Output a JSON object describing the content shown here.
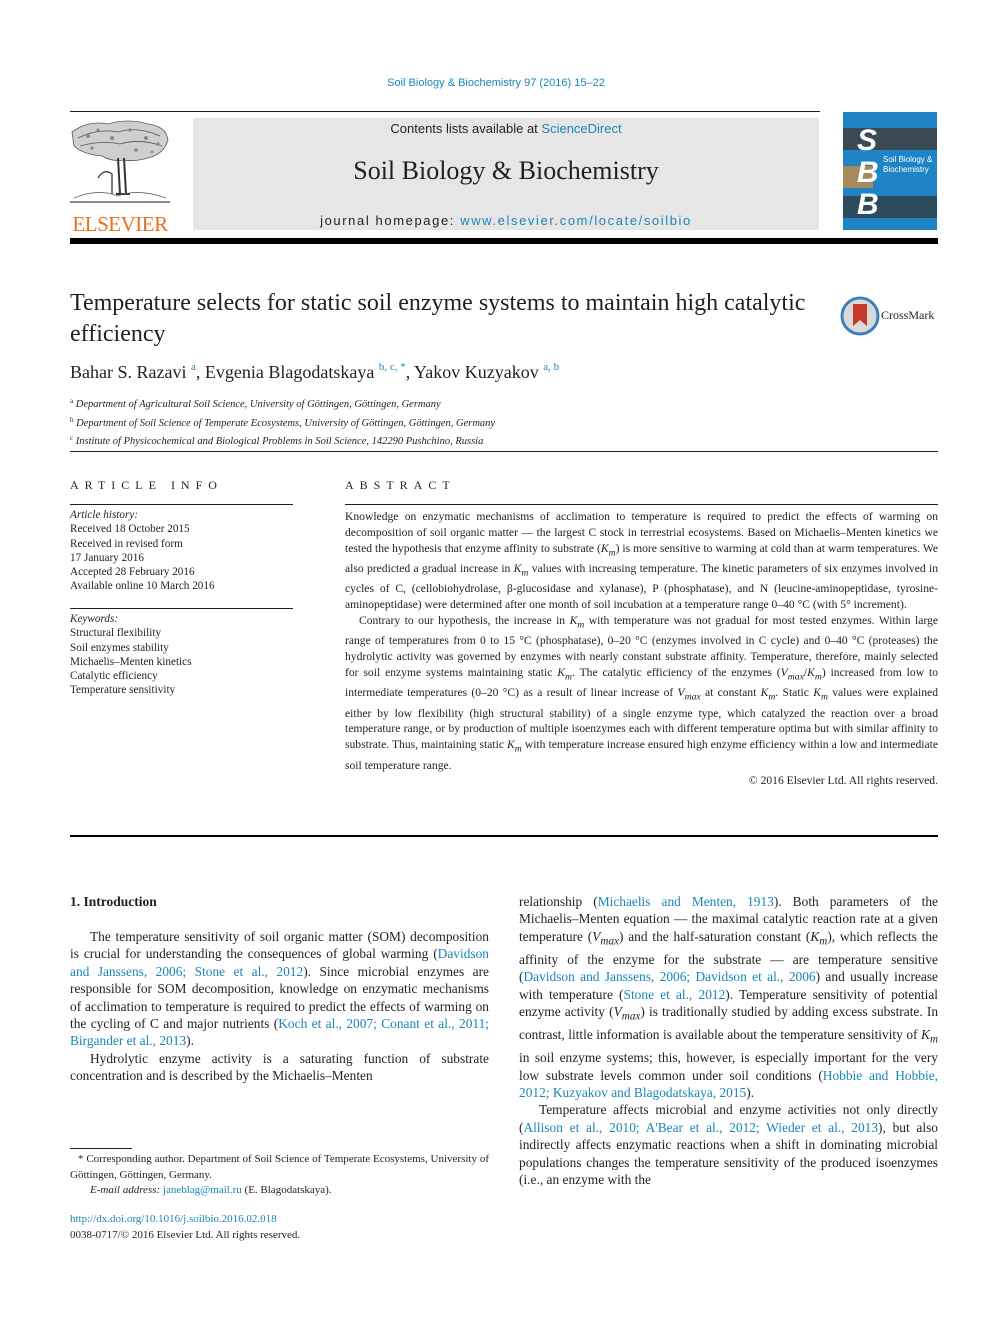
{
  "journal_reference": "Soil Biology & Biochemistry 97 (2016) 15–22",
  "masthead": {
    "publisher_logo_text": "ELSEVIER",
    "contents_prefix": "Contents lists available at ",
    "contents_link": "ScienceDirect",
    "journal_name": "Soil Biology & Biochemistry",
    "homepage_prefix": "journal homepage: ",
    "homepage_link": "www.elsevier.com/locate/soilbio",
    "cover": {
      "letters": [
        "S",
        "B",
        "B"
      ],
      "title_line1": "Soil Biology &",
      "title_line2": "Biochemistry",
      "background_color": "#1f84c6"
    }
  },
  "article": {
    "title": "Temperature selects for static soil enzyme systems to maintain high catalytic efficiency",
    "crossmark_label": "CrossMark",
    "authors": [
      {
        "name": "Bahar S. Razavi",
        "affil": "a"
      },
      {
        "name": "Evgenia Blagodatskaya",
        "affil": "b, c, *"
      },
      {
        "name": "Yakov Kuzyakov",
        "affil": "a, b"
      }
    ],
    "affiliations": [
      {
        "key": "a",
        "text": "Department of Agricultural Soil Science, University of Göttingen, Göttingen, Germany"
      },
      {
        "key": "b",
        "text": "Department of Soil Science of Temperate Ecosystems, University of Göttingen, Göttingen, Germany"
      },
      {
        "key": "c",
        "text": "Institute of Physicochemical and Biological Problems in Soil Science, 142290 Pushchino, Russia"
      }
    ]
  },
  "article_info": {
    "heading": "ARTICLE INFO",
    "history_label": "Article history:",
    "history": [
      "Received 18 October 2015",
      "Received in revised form",
      "17 January 2016",
      "Accepted 28 February 2016",
      "Available online 10 March 2016"
    ],
    "keywords_label": "Keywords:",
    "keywords": [
      "Structural flexibility",
      "Soil enzymes stability",
      "Michaelis–Menten kinetics",
      "Catalytic efficiency",
      "Temperature sensitivity"
    ]
  },
  "abstract": {
    "heading": "ABSTRACT",
    "p1": {
      "a": "Knowledge on enzymatic mechanisms of acclimation to temperature is required to predict the effects of warming on decomposition of soil organic matter — the largest C stock in terrestrial ecosystems. Based on Michaelis–Menten kinetics we tested the hypothesis that enzyme affinity to substrate (",
      "km1": "K",
      "km1_sub": "m",
      "b": ") is more sensitive to warming at cold than at warm temperatures. We also predicted a gradual increase in ",
      "km2": "K",
      "km2_sub": "m",
      "c": " values with increasing temperature. The kinetic parameters of six enzymes involved in cycles of C, (cellobiohydrolase, β-glucosidase and xylanase), P (phosphatase), and N (leucine-aminopeptidase, tyrosine-aminopeptidase) were determined after one month of soil incubation at a temperature range 0–40 °C (with 5° increment)."
    },
    "p2": {
      "a": "Contrary to our hypothesis, the increase in ",
      "b": " with temperature was not gradual for most tested enzymes. Within large range of temperatures from 0 to 15 °C (phosphatase), 0–20 °C (enzymes involved in C cycle) and 0–40 °C (proteases) the hydrolytic activity was governed by enzymes with nearly constant substrate affinity. Temperature, therefore, mainly selected for soil enzyme systems maintaining static ",
      "c": ". The catalytic efficiency of the enzymes (",
      "d": ") increased from low to intermediate temperatures (0–20 °C) as a result of linear increase of ",
      "e": " at constant ",
      "f": ". Static ",
      "g": " values were explained either by low flexibility (high structural stability) of a single enzyme type, which catalyzed the reaction over a broad temperature range, or by production of multiple isoenzymes each with different temperature optima but with similar affinity to substrate. Thus, maintaining static ",
      "h": " with temperature increase ensured high enzyme efficiency within a low and intermediate soil temperature range.",
      "K": "K",
      "m": "m",
      "V": "V",
      "max": "max",
      "slash": "/"
    },
    "copyright": "© 2016 Elsevier Ltd. All rights reserved."
  },
  "introduction": {
    "heading": "1.  Introduction",
    "left_p1": {
      "a": "The temperature sensitivity of soil organic matter (SOM) decomposition is crucial for understanding the consequences of global warming (",
      "cite1": "Davidson and Janssens, 2006; Stone et al., 2012",
      "b": "). Since microbial enzymes are responsible for SOM decomposition, knowledge on enzymatic mechanisms of acclimation to temperature is required to predict the effects of warming on the cycling of C and major nutrients (",
      "cite2": "Koch et al., 2007; Conant et al., 2011; Birgander et al., 2013",
      "c": ")."
    },
    "left_p2": "Hydrolytic enzyme activity is a saturating function of substrate concentration and is described by the Michaelis–Menten",
    "right_p1": {
      "a": "relationship (",
      "cite1": "Michaelis and Menten, 1913",
      "b": "). Both parameters of the Michaelis–Menten equation — the maximal catalytic reaction rate at a given temperature (",
      "c": ") and the half-saturation constant (",
      "d": "), which reflects the affinity of the enzyme for the substrate — are temperature sensitive (",
      "cite2": "Davidson and Janssens, 2006; Davidson et al., 2006",
      "e": ") and usually increase with temperature (",
      "cite3": "Stone et al., 2012",
      "f": "). Temperature sensitivity of potential enzyme activity (",
      "g": ") is traditionally studied by adding excess substrate. In contrast, little information is available about the temperature sensitivity of ",
      "h": " in soil enzyme systems; this, however, is especially important for the very low substrate levels common under soil conditions (",
      "cite4": "Hobbie and Hobbie, 2012; Kuzyakov and Blagodatskaya, 2015",
      "i": ")."
    },
    "right_p2": {
      "a": "Temperature affects microbial and enzyme activities not only directly (",
      "cite1": "Allison et al., 2010; A'Bear et al., 2012; Wieder et al., 2013",
      "b": "), but also indirectly affects enzymatic reactions when a shift in dominating microbial populations changes the temperature sensitivity of the produced isoenzymes (i.e., an enzyme with the"
    }
  },
  "footnotes": {
    "corresponding": "* Corresponding author. Department of Soil Science of Temperate Ecosystems, University of Göttingen, Göttingen, Germany.",
    "email_label": "E-mail address: ",
    "email": "janeblag@mail.ru",
    "email_suffix": " (E. Blagodatskaya).",
    "doi": "http://dx.doi.org/10.1016/j.soilbio.2016.02.018",
    "issn_copyright": "0038-0717/© 2016 Elsevier Ltd. All rights reserved."
  },
  "colors": {
    "link": "#1a86b8",
    "elsevier_orange": "#e9711c",
    "masthead_bg": "#e6e6e6"
  }
}
